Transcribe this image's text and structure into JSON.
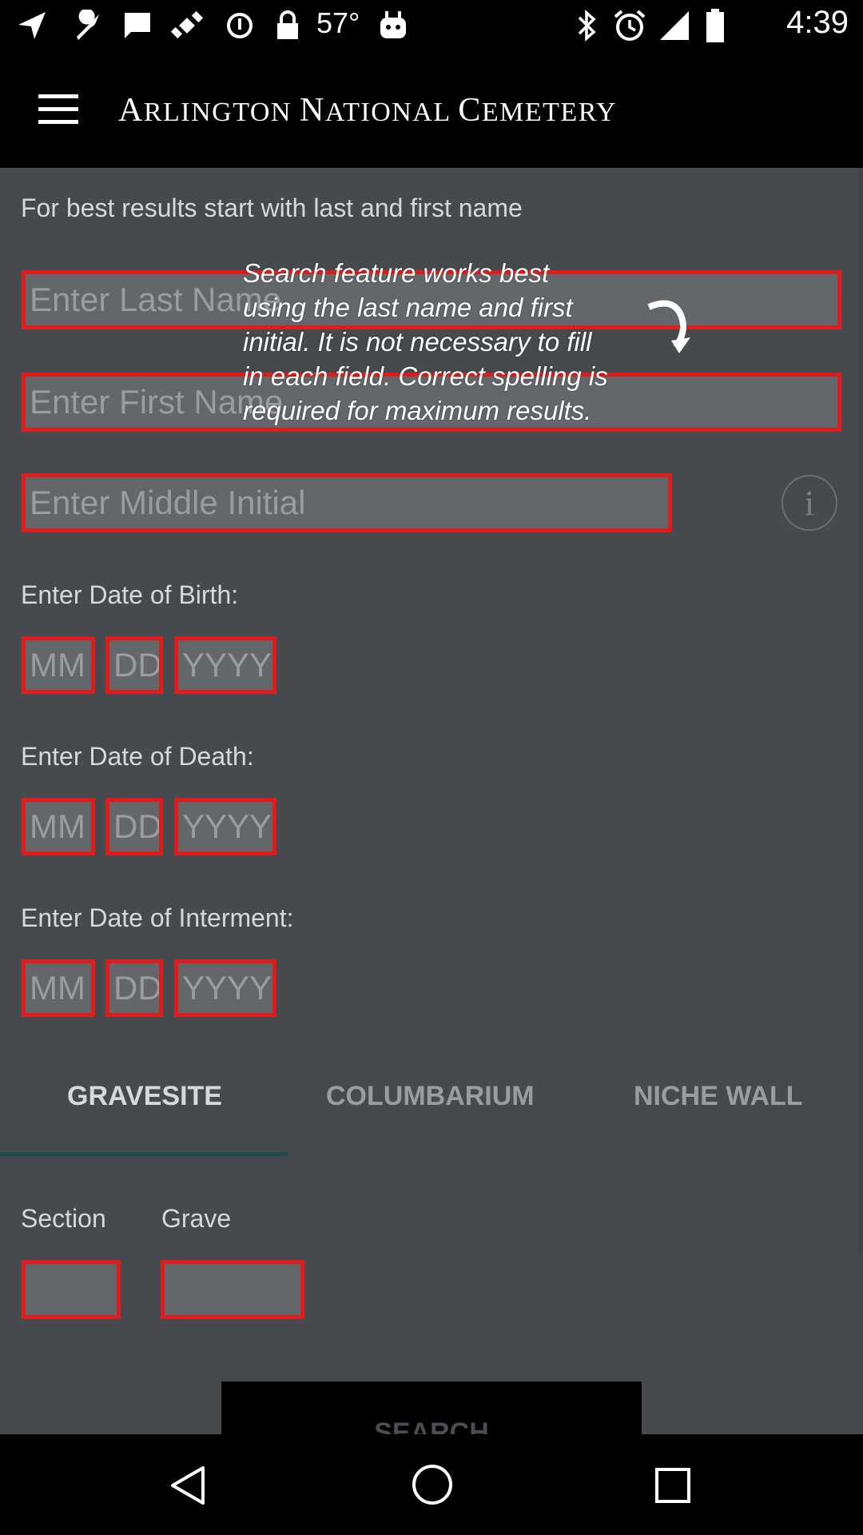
{
  "status_bar": {
    "time": "4:39",
    "temperature": "57°",
    "icons": [
      "navigation-icon",
      "wrench-icon",
      "message-icon",
      "satellite-icon",
      "restricted-icon",
      "lock-icon",
      "android-icon",
      "bluetooth-icon",
      "alarm-icon",
      "signal-icon",
      "battery-icon"
    ]
  },
  "app_bar": {
    "title_first": "A",
    "title_rest": "RLINGTON ",
    "title_first2": "N",
    "title_rest2": "ATIONAL ",
    "title_first3": "C",
    "title_rest3": "EMETERY"
  },
  "hint": "For best results start with last and first name",
  "fields": {
    "last_name_placeholder": "Enter Last Name",
    "first_name_placeholder": "Enter First Name",
    "middle_initial_placeholder": "Enter Middle Initial"
  },
  "tooltip": "Search feature works best using the last name and first initial. It is not necessary to fill in each field. Correct spelling is required for maximum results.",
  "dates": {
    "birth_label": "Enter Date of Birth:",
    "death_label": "Enter Date of Death:",
    "interment_label": "Enter Date of Interment:",
    "mm": "MM",
    "dd": "DD",
    "yyyy": "YYYY"
  },
  "tabs": {
    "gravesite": "GRAVESITE",
    "columbarium": "COLUMBARIUM",
    "niche_wall": "NICHE WALL",
    "selected": "GRAVESITE"
  },
  "location": {
    "section_label": "Section",
    "grave_label": "Grave"
  },
  "search_button": "SEARCH",
  "colors": {
    "field_border": "#e01b1b",
    "background": "#464a4e",
    "tab_indicator": "#1b4d48"
  }
}
